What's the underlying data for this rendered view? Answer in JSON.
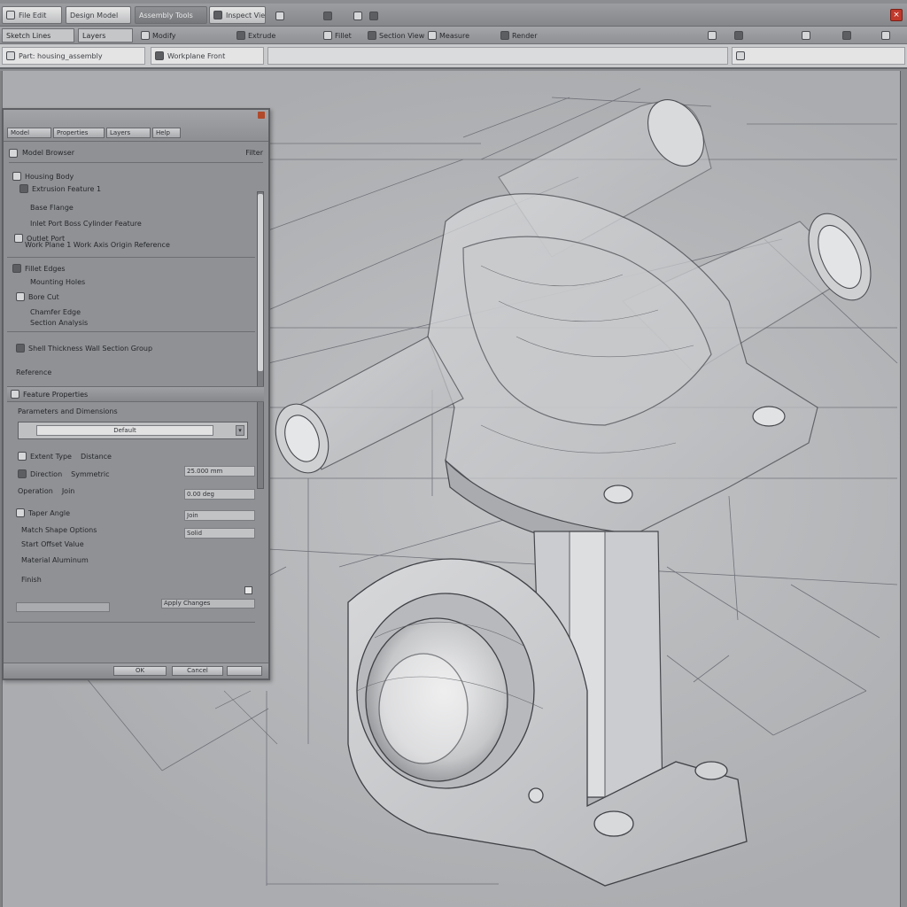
{
  "app": {
    "title_tabs": [
      {
        "label": "File Edit"
      },
      {
        "label": "Design Model"
      },
      {
        "label": "Assembly Tools"
      },
      {
        "label": "Inspect View"
      }
    ],
    "toolbar": [
      {
        "label": "Sketch Lines"
      },
      {
        "label": "Layers"
      },
      {
        "label": "Modify"
      },
      {
        "label": "Extrude"
      },
      {
        "label": "Fillet"
      },
      {
        "label": "Section View"
      },
      {
        "label": "Measure"
      },
      {
        "label": "Render"
      }
    ],
    "toolbar_right_icons": [
      "grid-icon",
      "snap-icon",
      "ortho-icon",
      "view-cube-icon",
      "settings-icon"
    ],
    "address_left": "Part: housing_assembly",
    "address_mid": "Workplane Front",
    "command_field": "",
    "close_label": "×",
    "accent_close": "#c0392b"
  },
  "panel": {
    "tabs": [
      "Model",
      "Properties",
      "Layers",
      "Help"
    ],
    "section_title": "Model Browser",
    "section_right": "Filter",
    "items": [
      {
        "label": "Housing Body"
      },
      {
        "label": "Extrusion Feature 1"
      },
      {
        "label": "Base Flange"
      },
      {
        "label": "Inlet Port Boss Cylinder Feature"
      },
      {
        "label": "Outlet Port"
      },
      {
        "label": "Work Plane 1 Work Axis Origin Reference"
      },
      {
        "label": "Fillet Edges"
      },
      {
        "label": "Mounting Holes"
      },
      {
        "label": "Bore Cut"
      },
      {
        "label": "Chamfer Edge"
      },
      {
        "label": "Section Analysis"
      },
      {
        "label": "Shell Thickness Wall Section Group"
      },
      {
        "label": "Reference"
      }
    ],
    "properties_header": "Feature Properties",
    "properties_sub": "Parameters and Dimensions",
    "combo_value": "Default",
    "props": [
      {
        "label": "Extent Type",
        "value": "Distance"
      },
      {
        "label": "Direction",
        "value": "Symmetric"
      },
      {
        "label": "Operation",
        "value": "Join"
      },
      {
        "label": "Taper Angle"
      },
      {
        "label": "Match Shape Options"
      },
      {
        "label": "Start Offset Value"
      },
      {
        "label": "Material Aluminum"
      },
      {
        "label": "Finish"
      }
    ],
    "right_fields": [
      "25.000 mm",
      "0.00 deg",
      "Join",
      "Solid"
    ],
    "bottom_fields": [
      "Apply Changes"
    ],
    "footer_buttons": [
      "OK",
      "Cancel"
    ]
  }
}
